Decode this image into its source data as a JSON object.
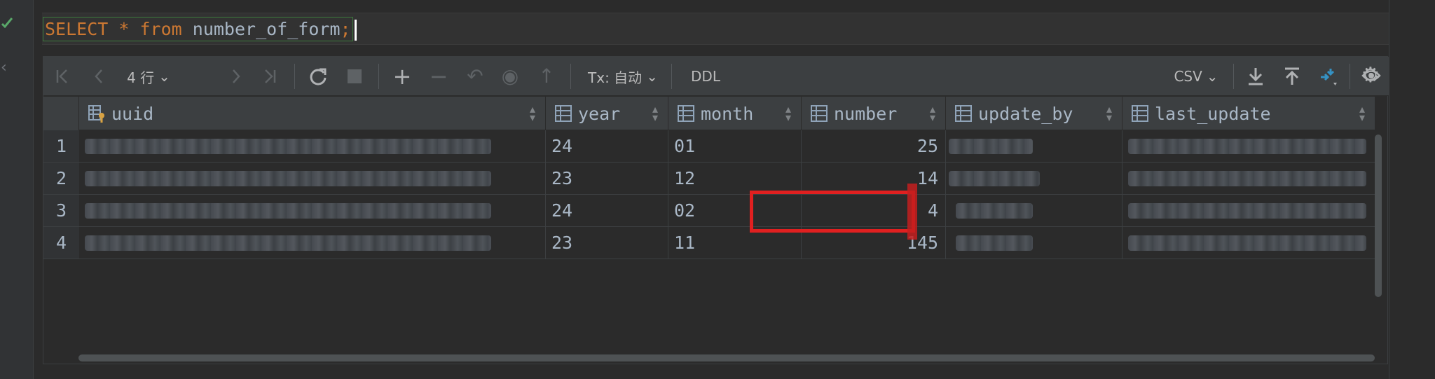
{
  "editor": {
    "sql_keyword_select": "SELECT",
    "sql_star": "*",
    "sql_keyword_from": "from",
    "sql_table": "number_of_form",
    "sql_semicolon": ";"
  },
  "toolbar": {
    "rows_label": "4 行",
    "tx_label": "Tx: 自动",
    "ddl_label": "DDL",
    "export_format": "CSV"
  },
  "grid": {
    "columns": [
      "uuid",
      "year",
      "month",
      "number",
      "update_by",
      "last_update"
    ],
    "row_numbers": [
      "1",
      "2",
      "3",
      "4"
    ],
    "rows": [
      {
        "year": "24",
        "month": "01",
        "number": "25"
      },
      {
        "year": "23",
        "month": "12",
        "number": "14"
      },
      {
        "year": "24",
        "month": "02",
        "number": "4"
      },
      {
        "year": "23",
        "month": "11",
        "number": "145"
      }
    ]
  },
  "colors": {
    "background": "#2b2b2b",
    "toolbar": "#3c3f41",
    "keyword": "#cc7832",
    "text": "#a9b7c6",
    "highlight": "#e02020",
    "accent_blue": "#3592c4"
  }
}
